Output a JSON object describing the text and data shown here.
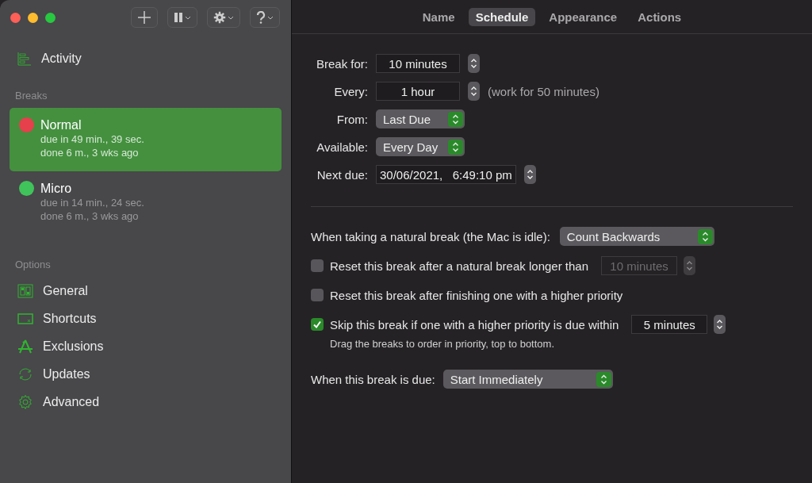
{
  "sidebar": {
    "activity": {
      "label": "Activity"
    },
    "breaks_heading": "Breaks",
    "breaks": [
      {
        "name": "Normal",
        "due": "due in 49 min., 39 sec.",
        "done": "done 6 m., 3 wks ago",
        "color": "#e5404b",
        "selected": true
      },
      {
        "name": "Micro",
        "due": "due in 14 min., 24 sec.",
        "done": "done 6 m., 3 wks ago",
        "color": "#3fc35a",
        "selected": false
      }
    ],
    "options_heading": "Options",
    "options": [
      {
        "label": "General",
        "kind": "general"
      },
      {
        "label": "Shortcuts",
        "kind": "shortcuts"
      },
      {
        "label": "Exclusions",
        "kind": "exclusions"
      },
      {
        "label": "Updates",
        "kind": "updates"
      },
      {
        "label": "Advanced",
        "kind": "advanced"
      }
    ]
  },
  "tabs": [
    {
      "label": "Name",
      "selected": false
    },
    {
      "label": "Schedule",
      "selected": true
    },
    {
      "label": "Appearance",
      "selected": false
    },
    {
      "label": "Actions",
      "selected": false
    }
  ],
  "schedule": [
    {
      "kind": "stepper",
      "label": "Break for:",
      "value": "10 minutes"
    },
    {
      "kind": "stepper",
      "label": "Every:",
      "value": "1 hour",
      "note": "(work for 50 minutes)"
    },
    {
      "kind": "popup",
      "label": "From:",
      "value": "Last Due"
    },
    {
      "kind": "popup",
      "label": "Available:",
      "value": "Every Day"
    },
    {
      "kind": "date",
      "label": "Next due:",
      "value": "30/06/2021,   6:49:10 pm"
    }
  ],
  "natural_break": {
    "label": "When taking a natural break (the Mac is idle):",
    "value": "Count Backwards"
  },
  "options": [
    {
      "label": "Reset this break after a natural break longer than",
      "checked": false,
      "field": {
        "value": "10 minutes",
        "disabled": true
      }
    },
    {
      "label": "Reset this break after finishing one with a higher priority",
      "checked": false
    },
    {
      "label": "Skip this break if one with a higher priority is due within",
      "checked": true,
      "field": {
        "value": "5 minutes",
        "disabled": false
      },
      "hint": "Drag the breaks to order in priority, top to bottom."
    }
  ],
  "when_due": {
    "label": "When this break is due:",
    "value": "Start Immediately"
  }
}
